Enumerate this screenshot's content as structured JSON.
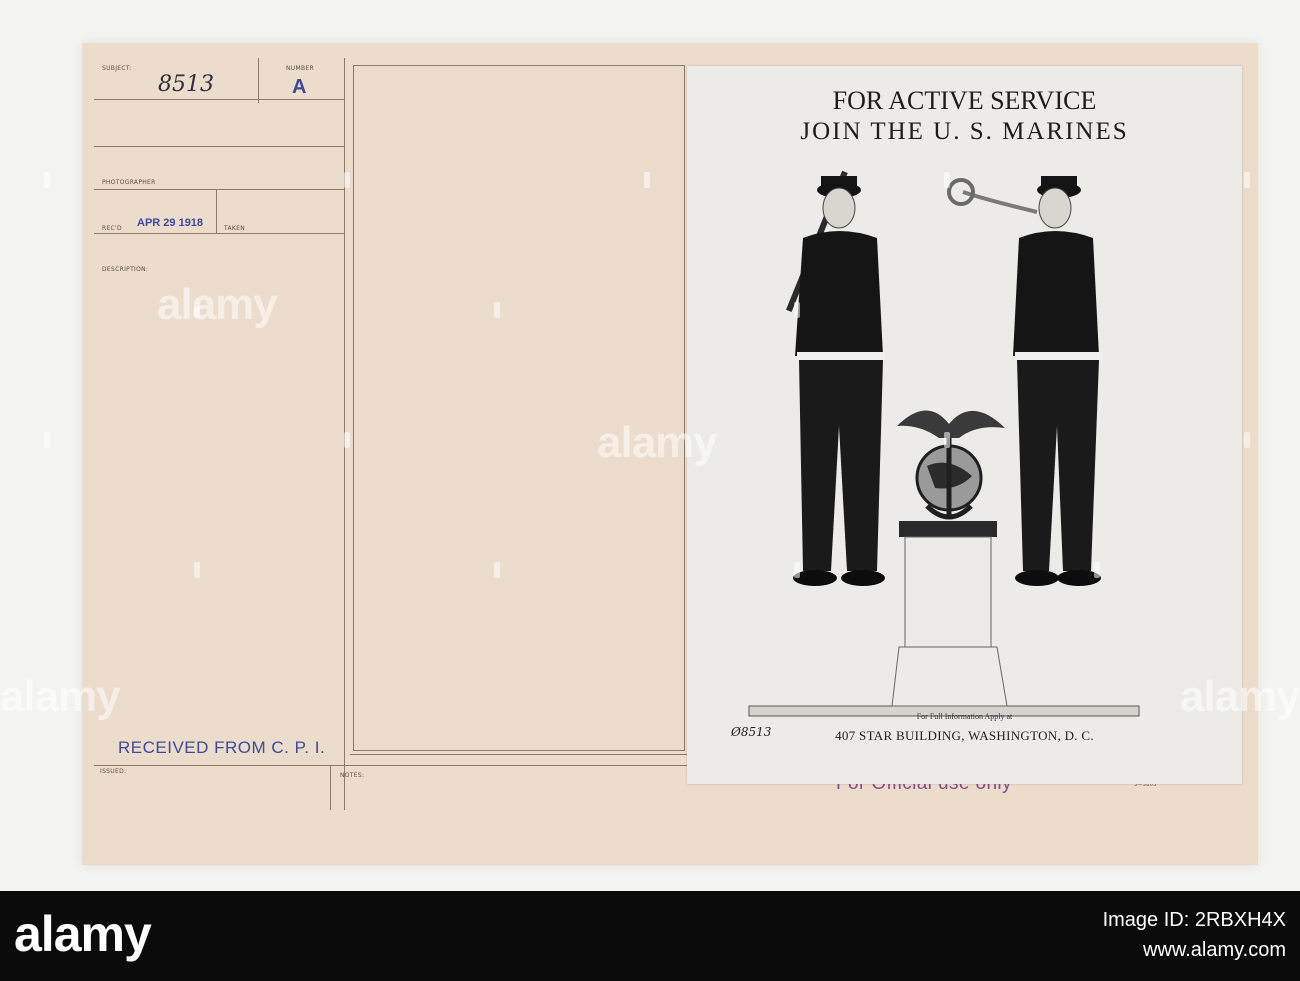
{
  "card": {
    "subject_label": "SUBJECT:",
    "subject_number": "8513",
    "number_label": "NUMBER",
    "number_value": "A",
    "photographer_label": "PHOTOGRAPHER",
    "recd_label": "REC'D",
    "recd_date": "APR 29 1918",
    "taken_label": "TAKEN",
    "description_label": "DESCRIPTION:",
    "received_from": "RECEIVED FROM C. P. I.",
    "issued_label": "ISSUED:",
    "notes_label": "NOTES:",
    "official_stamp": "For Official use only",
    "corner_code": "3—5805"
  },
  "poster": {
    "title_line1": "FOR ACTIVE SERVICE",
    "title_line2": "JOIN THE U. S. MARINES",
    "info_line": "For Full Information Apply at",
    "address": "407 STAR BUILDING, WASHINGTON, D. C.",
    "plate_number": "Ø8513"
  },
  "watermark": {
    "text": "alamy"
  },
  "footer": {
    "logo": "alamy",
    "image_id_caption": "Image ID: 2RBXH4X",
    "site": "www.alamy.com"
  },
  "colors": {
    "card": "#ecdccb",
    "stamp_blue": "#3d4a9a",
    "stamp_purple": "#8a4a8e",
    "footer_bg": "#0b0b0b"
  }
}
